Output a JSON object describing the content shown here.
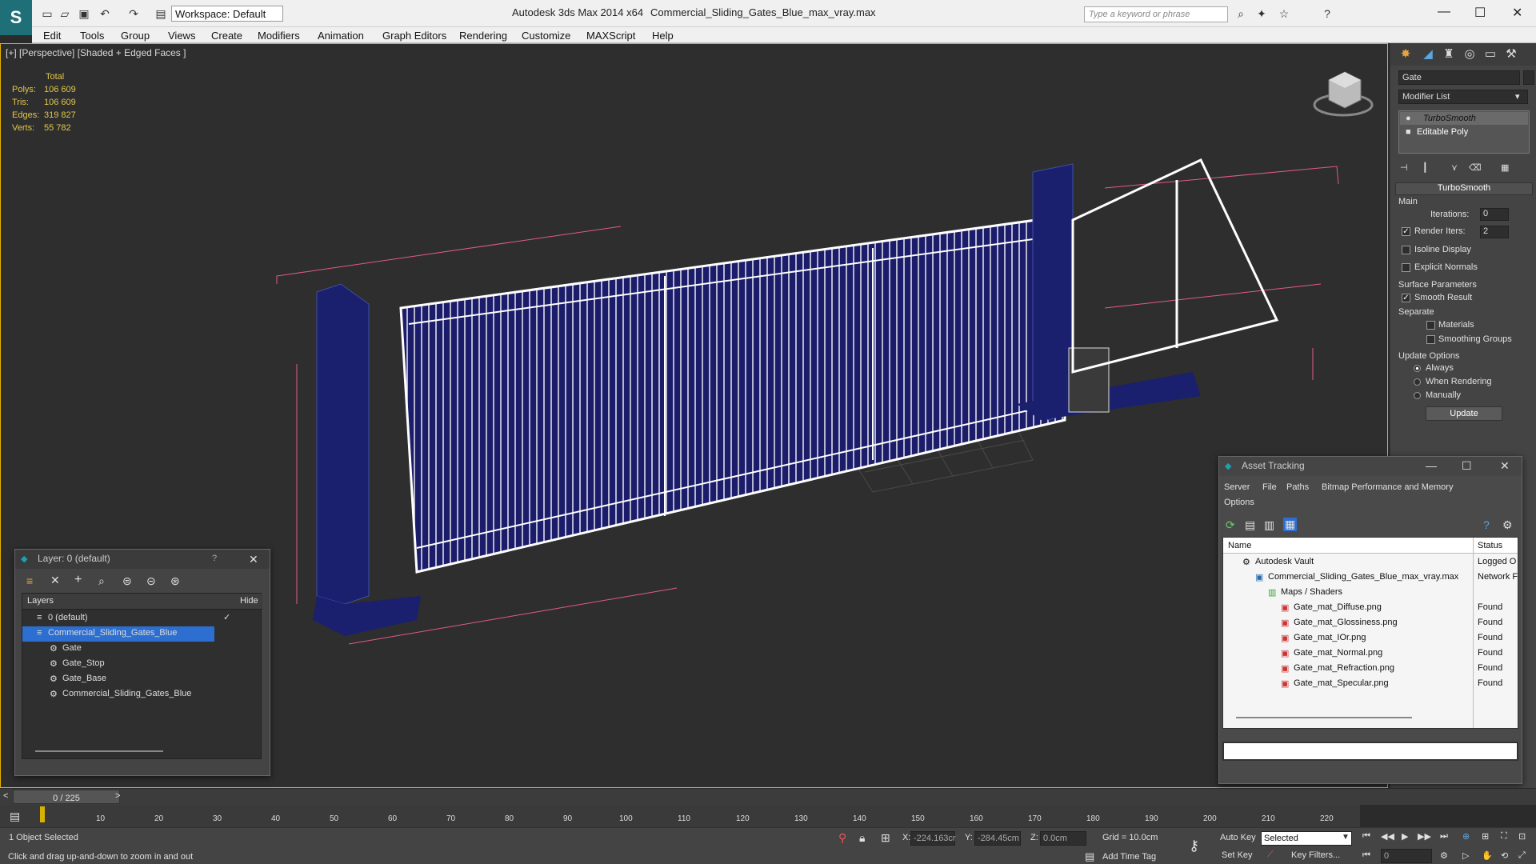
{
  "app": {
    "title": "Autodesk 3ds Max  2014 x64",
    "file": "Commercial_Sliding_Gates_Blue_max_vray.max",
    "workspace": "Workspace: Default",
    "search_placeholder": "Type a keyword or phrase",
    "accent": "#e3b100"
  },
  "menu": [
    "Edit",
    "Tools",
    "Group",
    "Views",
    "Create",
    "Modifiers",
    "Animation",
    "Graph Editors",
    "Rendering",
    "Customize",
    "MAXScript",
    "Help"
  ],
  "viewport": {
    "label": "[+] [Perspective] [Shaded + Edged Faces ]",
    "stats_header": "Total",
    "stats": [
      {
        "k": "Polys:",
        "v": "106 609"
      },
      {
        "k": "Tris:",
        "v": "106 609"
      },
      {
        "k": "Edges:",
        "v": "319 827"
      },
      {
        "k": "Verts:",
        "v": "55 782"
      }
    ]
  },
  "command_panel": {
    "object_name": "Gate",
    "modifier_list": "Modifier List",
    "stack": [
      "TurboSmooth",
      "Editable Poly"
    ],
    "rollout_title": "TurboSmooth",
    "main": "Main",
    "iterations_label": "Iterations:",
    "iterations": "0",
    "render_iters_label": "Render Iters:",
    "render_iters": "2",
    "isoline": "Isoline Display",
    "explicit": "Explicit Normals",
    "surface": "Surface Parameters",
    "smooth_result": "Smooth Result",
    "separate": "Separate",
    "materials": "Materials",
    "smoothing_groups": "Smoothing Groups",
    "update_options": "Update Options",
    "always": "Always",
    "when_rendering": "When Rendering",
    "manually": "Manually",
    "update": "Update"
  },
  "layer_dialog": {
    "title": "Layer: 0 (default)",
    "help": "?",
    "col_layers": "Layers",
    "col_hide": "Hide",
    "rows": [
      "0 (default)",
      "Commercial_Sliding_Gates_Blue",
      "Gate",
      "Gate_Stop",
      "Gate_Base",
      "Commercial_Sliding_Gates_Blue"
    ]
  },
  "asset_tracking": {
    "title": "Asset Tracking",
    "menu": [
      "Server",
      "File",
      "Paths",
      "Bitmap Performance and Memory",
      "Options"
    ],
    "col_name": "Name",
    "col_status": "Status",
    "rows": [
      {
        "name": "Autodesk Vault",
        "status": "Logged O"
      },
      {
        "name": "Commercial_Sliding_Gates_Blue_max_vray.max",
        "status": "Network F"
      },
      {
        "name": "Maps / Shaders",
        "status": ""
      },
      {
        "name": "Gate_mat_Diffuse.png",
        "status": "Found"
      },
      {
        "name": "Gate_mat_Glossiness.png",
        "status": "Found"
      },
      {
        "name": "Gate_mat_IOr.png",
        "status": "Found"
      },
      {
        "name": "Gate_mat_Normal.png",
        "status": "Found"
      },
      {
        "name": "Gate_mat_Refraction.png",
        "status": "Found"
      },
      {
        "name": "Gate_mat_Specular.png",
        "status": "Found"
      }
    ]
  },
  "timeline": {
    "frame": "0 / 225",
    "ticks": [
      "10",
      "20",
      "30",
      "40",
      "50",
      "60",
      "70",
      "80",
      "90",
      "100",
      "110",
      "120",
      "130",
      "140",
      "150",
      "160",
      "170",
      "180",
      "190",
      "200",
      "210",
      "220"
    ]
  },
  "status": {
    "selected": "1 Object Selected",
    "hint": "Click and drag up-and-down to zoom in and out",
    "x_label": "X:",
    "x": "-224.163cr",
    "y_label": "Y:",
    "y": "-284.45cm",
    "z_label": "Z:",
    "z": "0.0cm",
    "grid": "Grid = 10.0cm",
    "add_time_tag": "Add Time Tag",
    "auto_key": "Auto Key",
    "set_key": "Set Key",
    "selected_dd": "Selected",
    "key_filters": "Key Filters...",
    "frame_field": "0"
  }
}
